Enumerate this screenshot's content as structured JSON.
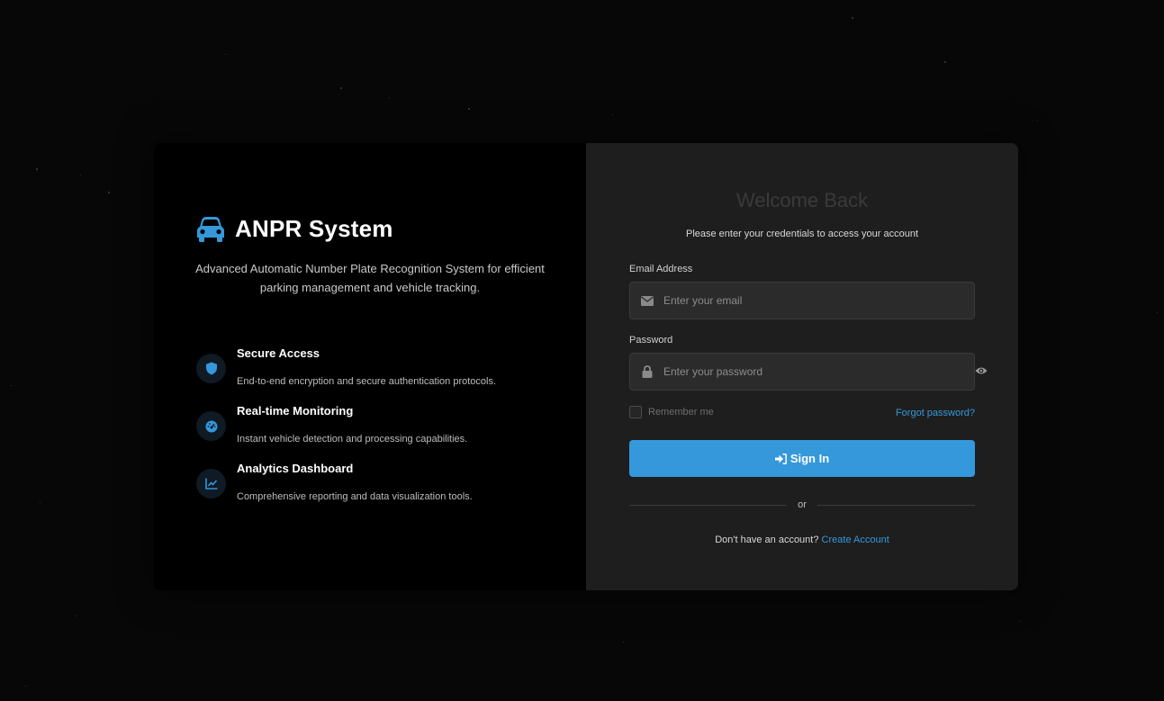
{
  "brand": {
    "title": "ANPR System",
    "description": "Advanced Automatic Number Plate Recognition System for efficient parking management and vehicle tracking.",
    "icon": "car-icon",
    "accent_color": "#3498db"
  },
  "features": [
    {
      "title": "Secure Access",
      "description": "End-to-end encryption and secure authentication protocols.",
      "icon": "shield-icon"
    },
    {
      "title": "Real-time Monitoring",
      "description": "Instant vehicle detection and processing capabilities.",
      "icon": "gauge-icon"
    },
    {
      "title": "Analytics Dashboard",
      "description": "Comprehensive reporting and data visualization tools.",
      "icon": "chart-line-icon"
    }
  ],
  "login": {
    "heading": "Welcome Back",
    "subtitle": "Please enter your credentials to access your account",
    "email_label": "Email Address",
    "email_placeholder": "Enter your email",
    "email_value": "",
    "password_label": "Password",
    "password_placeholder": "Enter your password",
    "password_value": "",
    "remember_label": "Remember me",
    "remember_checked": false,
    "forgot_label": "Forgot password?",
    "signin_label": "Sign In",
    "divider_label": "or",
    "signup_prompt": "Don't have an account?",
    "signup_link": "Create Account"
  }
}
